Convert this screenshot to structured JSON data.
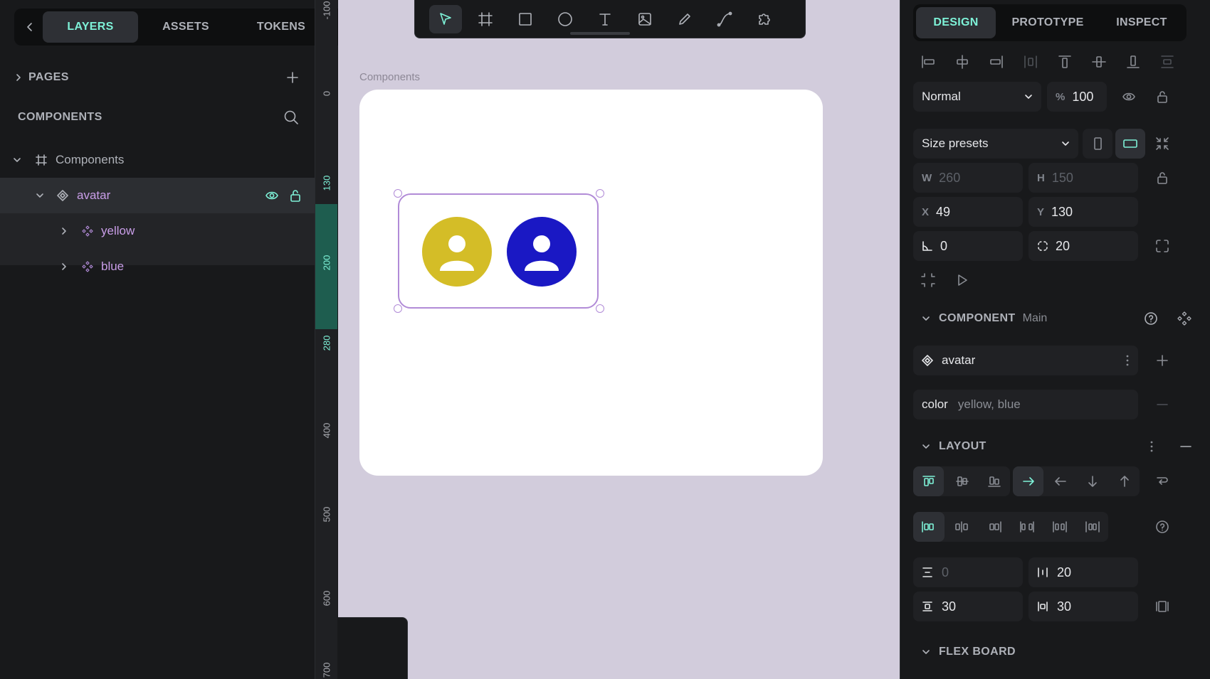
{
  "left": {
    "tabs": [
      {
        "label": "LAYERS"
      },
      {
        "label": "ASSETS"
      },
      {
        "label": "TOKENS"
      }
    ],
    "pages_label": "PAGES",
    "section_label": "COMPONENTS",
    "layers": [
      {
        "name": "Components",
        "icon": "board-icon"
      },
      {
        "name": "avatar",
        "icon": "component-icon"
      },
      {
        "name": "yellow",
        "icon": "copy-icon"
      },
      {
        "name": "blue",
        "icon": "copy-icon"
      }
    ]
  },
  "ruler": {
    "ticks": [
      "-100",
      "0",
      "130",
      "200",
      "280",
      "400",
      "500",
      "600",
      "700"
    ]
  },
  "canvas": {
    "board_title": "Components",
    "avatar_colors": {
      "yellow": "#d4bd27",
      "blue": "#1a18c4"
    },
    "selection_color": "#b18bd7",
    "accent": "#7ef2d8"
  },
  "toolbar": {
    "tools": [
      "move-tool",
      "board-tool",
      "rectangle-tool",
      "ellipse-tool",
      "text-tool",
      "image-tool",
      "pencil-tool",
      "path-tool",
      "plugins-tool"
    ]
  },
  "right": {
    "tabs": [
      {
        "label": "DESIGN"
      },
      {
        "label": "PROTOTYPE"
      },
      {
        "label": "INSPECT"
      }
    ],
    "blend": "Normal",
    "opacity_symbol": "%",
    "opacity": "100",
    "size_presets": "Size presets",
    "w_label": "W",
    "w": "260",
    "h_label": "H",
    "h": "150",
    "x_label": "X",
    "x": "49",
    "y_label": "Y",
    "y": "130",
    "rotation": "0",
    "radius": "20",
    "component_label": "COMPONENT",
    "component_kind": "Main",
    "component_name": "avatar",
    "variant_key": "color",
    "variant_value": "yellow, blue",
    "layout_label": "LAYOUT",
    "row_gap": "0",
    "col_gap": "20",
    "pad_v": "30",
    "pad_h": "30",
    "flex_label": "FLEX BOARD"
  }
}
